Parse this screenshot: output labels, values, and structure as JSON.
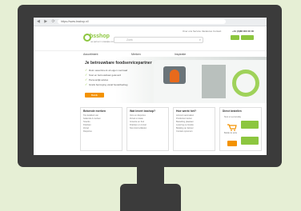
{
  "colors": {
    "background": "#e6efd5",
    "monitor": "#3b3b3b",
    "brand_green": "#8cc63f",
    "accent_orange": "#f39200"
  },
  "browser": {
    "url": "https://www.bsshop.nl/"
  },
  "header": {
    "logo_word": "bsshop",
    "logo_sub": "uw partner in zakelijke zorg",
    "search_placeholder": "Zoek",
    "top_links": "Over ons   Service   Vacatures   Contact",
    "phone": "+31 (0)88 000 00 00",
    "login_label": "",
    "cart_label": ""
  },
  "nav": {
    "items": [
      "Assortiment",
      "Merken",
      "Inspiratie"
    ]
  },
  "hero": {
    "title": "Je betrouwbare foodservicepartner",
    "bullets": [
      "Ruim assortiment uit eigen voorraad",
      "Snel en betrouwbaar geleverd",
      "Persoonlijk advies",
      "Gratis bezorging vanaf bestelbedrag"
    ],
    "button_label": "Bekijk assortiment"
  },
  "boxes": [
    {
      "title": "Bekende merken",
      "lines": [
        "Top kwaliteit van",
        "bekende A-merken",
        "Snacks",
        "Dranken",
        "Zuivel",
        "Diepvries"
      ]
    },
    {
      "title": "Wat levert bsshop?",
      "lines": [
        "Vers en diepvries",
        "Zuivel en kaas",
        "Groente en fruit",
        "Dranken en zuivel",
        "Non-food artikelen"
      ]
    },
    {
      "title": "Hoe werkt het?",
      "lines": [
        "Account aanmaken",
        "Producten kiezen",
        "Bestelling plaatsen",
        "Levering op locatie",
        "Betaling op factuur",
        "Contact opnemen"
      ]
    },
    {
      "title": "Direct bestellen",
      "sub1": "Snel en eenvoudig",
      "sub2": "Bekijk de actie"
    }
  ]
}
